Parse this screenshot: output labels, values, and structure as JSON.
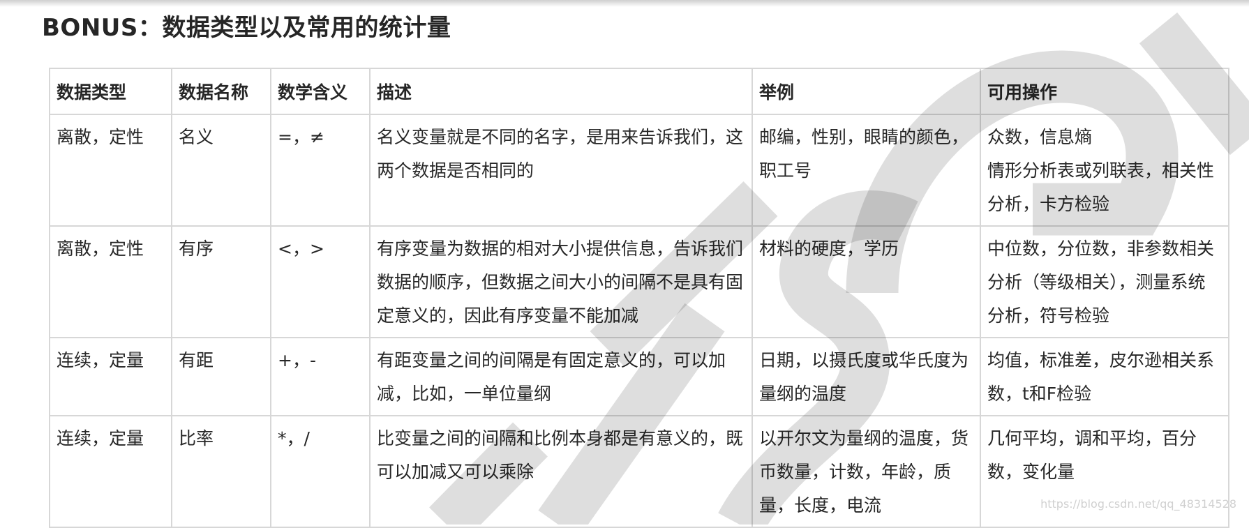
{
  "title": "BONUS：数据类型以及常用的统计量",
  "table": {
    "headers": [
      "数据类型",
      "数据名称",
      "数学含义",
      "描述",
      "举例",
      "可用操作"
    ],
    "rows": [
      {
        "type": "离散，定性",
        "name": "名义",
        "math": "=，≠",
        "description": "名义变量就是不同的名字，是用来告诉我们，这两个数据是否相同的",
        "example": "邮编，性别，眼睛的颜色，职工号",
        "operations": "众数，信息熵\n情形分析表或列联表，相关性分析，卡方检验"
      },
      {
        "type": "离散，定性",
        "name": "有序",
        "math": "<，>",
        "description": "有序变量为数据的相对大小提供信息，告诉我们数据的顺序，但数据之间大小的间隔不是具有固定意义的，因此有序变量不能加减",
        "example": "材料的硬度，学历",
        "operations": "中位数，分位数，非参数相关分析（等级相关），测量系统分析，符号检验"
      },
      {
        "type": "连续，定量",
        "name": "有距",
        "math": "+，-",
        "description": "有距变量之间的间隔是有固定意义的，可以加减，比如，一单位量纲",
        "example": "日期，以摄氏度或华氏度为量纲的温度",
        "operations": "均值，标准差，皮尔逊相关系数，t和F检验"
      },
      {
        "type": "连续，定量",
        "name": "比率",
        "math": "*，/",
        "description": "比变量之间的间隔和比例本身都是有意义的，既可以加减又可以乘除",
        "example": "以开尔文为量纲的温度，货币数量，计数，年龄，质量，长度，电流",
        "operations": "几何平均，调和平均，百分数，变化量"
      }
    ]
  },
  "watermark_url": "https://blog.csdn.net/qq_48314528"
}
